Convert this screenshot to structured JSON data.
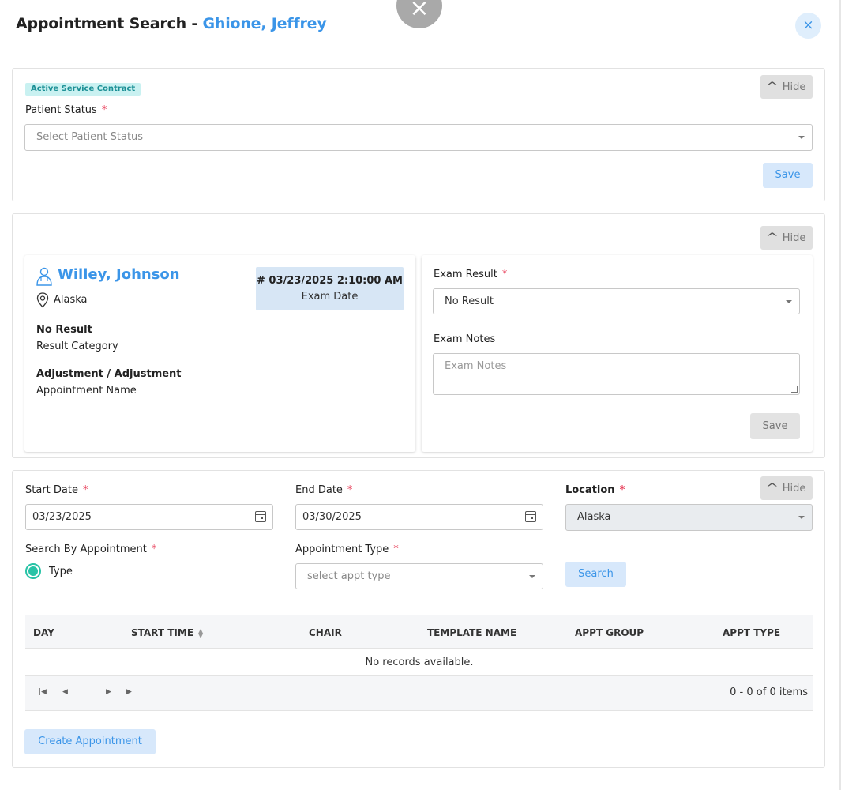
{
  "header": {
    "title": "Appointment Search - ",
    "patient_name": "Ghione, Jeffrey",
    "close_symbol": "×",
    "close_icon": "close-icon"
  },
  "status_card": {
    "badge": "Active Service Contract",
    "hide_label": "Hide",
    "patient_status_label": "Patient Status",
    "required_mark": "*",
    "patient_status_placeholder": "Select Patient Status",
    "save_label": "Save"
  },
  "exam_card": {
    "hide_label": "Hide",
    "doctor_name": "Willey, Johnson",
    "location": "Alaska",
    "exam_date": "# 03/23/2025 2:10:00 AM",
    "exam_date_label": "Exam Date",
    "result_value": "No Result",
    "result_caption": "Result Category",
    "appointment_value": "Adjustment / Adjustment",
    "appointment_caption": "Appointment Name",
    "exam_result_label": "Exam Result",
    "required_mark": "*",
    "exam_result_value": "No Result",
    "exam_notes_label": "Exam Notes",
    "exam_notes_placeholder": "Exam Notes",
    "save_label": "Save"
  },
  "search_card": {
    "hide_label": "Hide",
    "required_mark": "*",
    "start_date_label": "Start Date",
    "start_date_value": "03/23/2025",
    "end_date_label": "End Date",
    "end_date_value": "03/30/2025",
    "location_label": "Location",
    "location_value": "Alaska",
    "search_by_label": "Search By Appointment",
    "radio_option": "Type",
    "appt_type_label": "Appointment Type",
    "appt_type_placeholder": "select appt type",
    "search_label": "Search",
    "table": {
      "columns": [
        "DAY",
        "START TIME",
        "CHAIR",
        "TEMPLATE NAME",
        "APPT GROUP",
        "APPT TYPE"
      ],
      "empty_text": "No records available.",
      "pager_info": "0 - 0 of 0 items"
    },
    "create_label": "Create Appointment"
  },
  "colors": {
    "accent": "#3b95e8",
    "badge_bg": "#c9f1f1",
    "radio": "#27c3a6",
    "required": "#e8425c"
  }
}
